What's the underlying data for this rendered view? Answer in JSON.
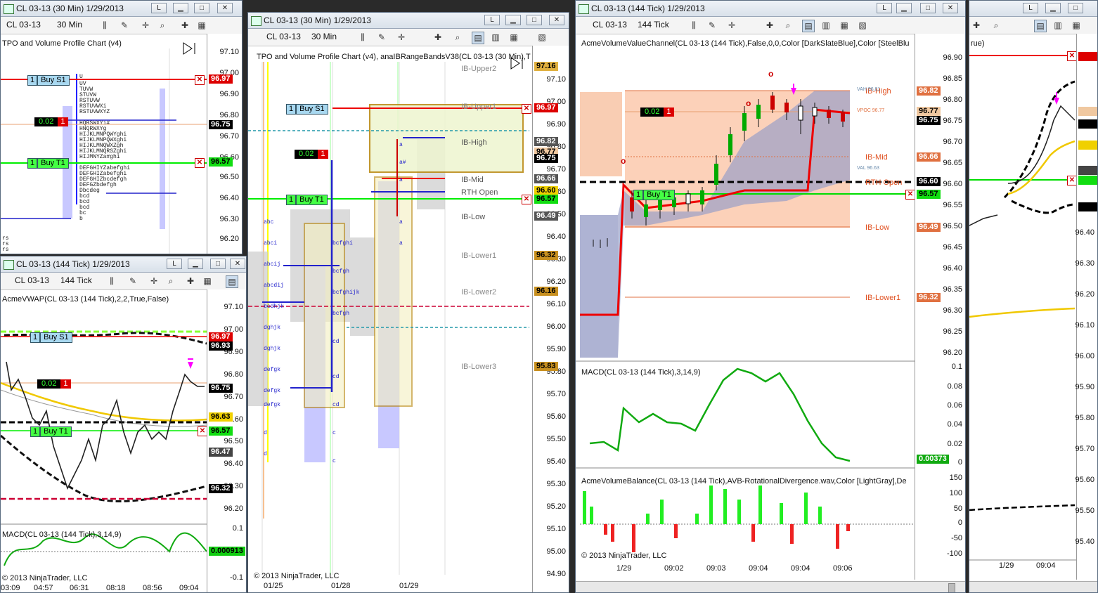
{
  "w1": {
    "title": "CL 03-13 (30 Min)  1/29/2013",
    "instrument": "CL 03-13",
    "interval": "30 Min",
    "indicator": "TPO and Volume Profile Chart (v4)",
    "ticks": [
      "97.10",
      "97.00",
      "96.90",
      "96.80",
      "96.70",
      "96.60",
      "96.50",
      "96.40",
      "96.30",
      "96.20"
    ],
    "price_labels": {
      "p1": "96.97",
      "p2": "96.75",
      "p3": "96.57"
    },
    "buy_s1": {
      "qty": "1",
      "name": "Buy S1"
    },
    "buy_t1": {
      "qty": "1",
      "name": "Buy T1"
    },
    "position": {
      "pnl": "0.02",
      "qty": "1"
    }
  },
  "w2": {
    "title": "CL 03-13 (144 Tick)  1/29/2013",
    "instrument": "CL 03-13",
    "interval": "144 Tick",
    "indicator": "AcmeVWAP(CL 03-13 (144 Tick),2,2,True,False)",
    "ticks": [
      "97.10",
      "97.00",
      "96.90",
      "96.80",
      "96.70",
      "96.60",
      "96.50",
      "96.40",
      "96.30",
      "96.20"
    ],
    "price_labels": {
      "p1": "96.97",
      "p2": "96.93",
      "p3": "96.75",
      "p4": "96.63",
      "p5": "96.57",
      "p6": "96.47",
      "p7": "96.32"
    },
    "buy_s1": {
      "qty": "1",
      "name": "Buy S1"
    },
    "buy_t1": {
      "qty": "1",
      "name": "Buy T1"
    },
    "position": {
      "pnl": "0.02",
      "qty": "1"
    },
    "macd_label": "MACD(CL 03-13 (144 Tick),3,14,9)",
    "macd_ticks": [
      "0.1",
      "-0.1"
    ],
    "macd_value": "0.000913",
    "copyright": "© 2013 NinjaTrader, LLC",
    "times": [
      "03:09",
      "04:57",
      "06:31",
      "08:18",
      "08:56",
      "09:04"
    ]
  },
  "w3": {
    "title": "CL 03-13 (30 Min)  1/29/2013",
    "instrument": "CL 03-13",
    "interval": "30 Min",
    "indicator": "TPO and Volume Profile Chart (v4), anaIBRangeBandsV38(CL 03-13 (30 Min),T",
    "ticks": [
      "97.10",
      "97.00",
      "96.90",
      "96.80",
      "96.70",
      "96.60",
      "96.50",
      "96.40",
      "96.30",
      "96.20",
      "96.10",
      "96.00",
      "95.90",
      "95.80",
      "95.70",
      "95.60",
      "95.50",
      "95.40",
      "95.30",
      "95.20",
      "95.10",
      "95.00",
      "94.90"
    ],
    "price_labels": {
      "p1": "97.16",
      "p2": "96.97",
      "p3": "96.82",
      "p4": "96.77",
      "p5": "96.75",
      "p6": "96.66",
      "p7": "96.60",
      "p8": "96.57",
      "p9": "96.49",
      "p10": "96.32",
      "p11": "96.16",
      "p12": "95.83"
    },
    "ib": {
      "upper2": "IB-Upper2",
      "upper1": "IB-Upper1",
      "high": "IB-High",
      "mid": "IB-Mid",
      "rth": "RTH Open",
      "low": "IB-Low",
      "lower1": "IB-Lower1",
      "lower2": "IB-Lower2",
      "lower3": "IB-Lower3"
    },
    "buy_s1": {
      "qty": "1",
      "name": "Buy S1"
    },
    "buy_t1": {
      "qty": "1",
      "name": "Buy T1"
    },
    "position": {
      "pnl": "0.02",
      "qty": "1"
    },
    "copyright": "© 2013 NinjaTrader, LLC",
    "dates": [
      "01/25",
      "01/28",
      "01/29"
    ]
  },
  "w4": {
    "title": "CL 03-13 (144 Tick)  1/29/2013",
    "instrument": "CL 03-13",
    "interval": "144 Tick",
    "indicator": "AcmeVolumeValueChannel(CL 03-13 (144 Tick),False,0,0,Color [DarkSlateBlue],Color [SteelBlu",
    "ticks": [
      "96.90",
      "96.85",
      "96.80",
      "96.75",
      "96.70",
      "96.65",
      "96.60",
      "96.55",
      "96.50",
      "96.45",
      "96.40",
      "96.35",
      "96.30",
      "96.25",
      "96.20"
    ],
    "price_labels": {
      "p1": "96.82",
      "p2": "96.77",
      "p3": "96.75",
      "p4": "96.66",
      "p5": "96.60",
      "p6": "96.57",
      "p7": "96.49",
      "p8": "96.32"
    },
    "ib": {
      "high": "IB-High",
      "mid": "IB-Mid",
      "rth": "RTH Open",
      "low": "IB-Low",
      "lower1": "IB-Lower1"
    },
    "small": {
      "vah": "VAH 96.81",
      "vpoc": "VPOC 96.77",
      "val": "VAL 96.63"
    },
    "buy_t1": {
      "qty": "1",
      "name": "Buy T1"
    },
    "position": {
      "pnl": "0.02",
      "qty": "1"
    },
    "macd_label": "MACD(CL 03-13 (144 Tick),3,14,9)",
    "macd_ticks": [
      "0.1",
      "0.08",
      "0.06",
      "0.04",
      "0.02",
      "0"
    ],
    "macd_value": "0.00373",
    "avb_label": "AcmeVolumeBalance(CL 03-13 (144 Tick),AVB-RotationalDivergence.wav,Color [LightGray],De",
    "avb_ticks": [
      "150",
      "100",
      "50",
      "0",
      "-50",
      "-100"
    ],
    "copyright": "© 2013 NinjaTrader, LLC",
    "times": [
      "1/29",
      "09:02",
      "09:03",
      "09:04",
      "09:04",
      "09:06"
    ]
  },
  "w5": {
    "label": "rue)",
    "ticks": [
      "96.40",
      "96.30",
      "96.20",
      "96.10",
      "96.00",
      "95.90",
      "95.80",
      "95.70",
      "95.60",
      "95.50",
      "95.40"
    ],
    "times": [
      "1/29",
      "09:04"
    ]
  }
}
